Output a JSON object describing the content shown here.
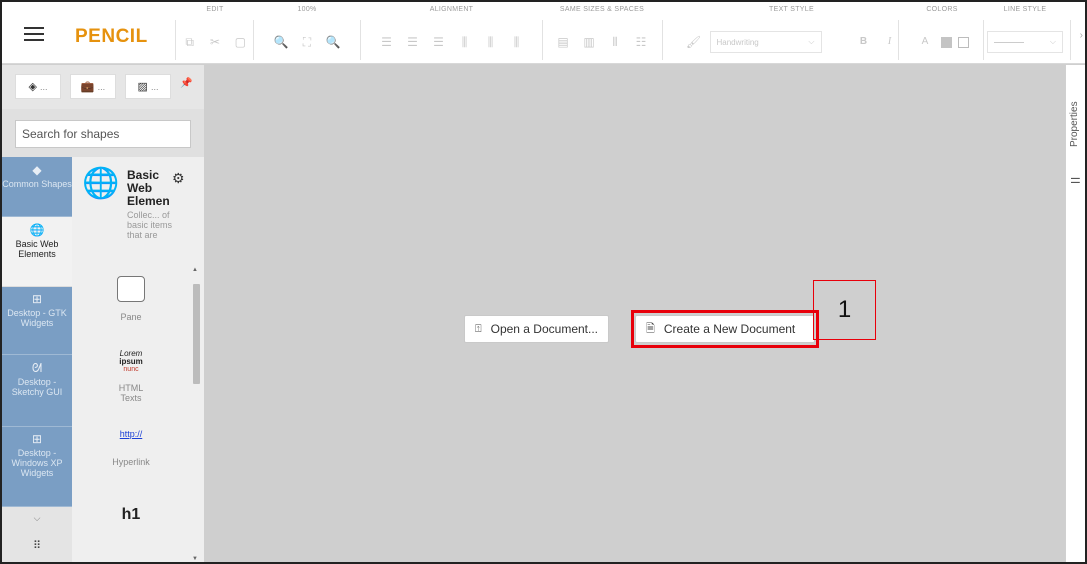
{
  "app": {
    "title": "PENCIL"
  },
  "toolbar": {
    "groups": {
      "edit": "EDIT",
      "zoom": "100%",
      "alignment": "ALIGNMENT",
      "same_sizes": "SAME SIZES & SPACES",
      "text_style": "TEXT STYLE",
      "colors": "COLORS",
      "line_style": "LINE STYLE"
    },
    "font_value": "Handwriting",
    "bold": "B",
    "italic": "I",
    "text_color": "A",
    "more_arrow": "›"
  },
  "left_panel": {
    "search_placeholder": "Search for shapes",
    "tab_dots": "...",
    "collection": {
      "title": "Basic Web Elemen",
      "description": "Collec... of basic items that are"
    },
    "categories": [
      {
        "label": "Common Shapes"
      },
      {
        "label": "Basic Web Elements"
      },
      {
        "label": "Desktop - GTK Widgets"
      },
      {
        "label": "Desktop - Sketchy GUI"
      },
      {
        "label": "Desktop - Windows XP Widgets"
      }
    ],
    "shapes": {
      "pane": "Pane",
      "lorem1": "Lorem",
      "lorem2": "ipsum",
      "lorem3": "nunc",
      "html_texts": "HTML Texts",
      "hyperlink_sample": "http://",
      "hyperlink": "Hyperlink",
      "h1": "h1"
    }
  },
  "canvas": {
    "open_label": "Open a Document...",
    "create_label": "Create a New Document",
    "annotation": "1"
  },
  "right_panel": {
    "properties": "Properties"
  },
  "colors": {
    "accent": "#e6920e",
    "category_blue": "#7a9ec4",
    "highlight": "#e8000b",
    "canvas": "#cfcfcf"
  }
}
